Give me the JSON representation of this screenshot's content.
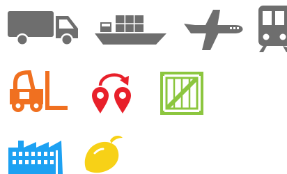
{
  "colors": {
    "gray": "#6e6e6e",
    "orange": "#f07020",
    "red": "#e8202a",
    "green": "#8cc63f",
    "blue": "#1da1f2",
    "yellow": "#f7d117",
    "white": "#ffffff"
  },
  "icons": [
    {
      "name": "truck-icon"
    },
    {
      "name": "cargo-ship-icon"
    },
    {
      "name": "airplane-icon"
    },
    {
      "name": "train-icon"
    },
    {
      "name": "forklift-icon"
    },
    {
      "name": "route-pins-icon"
    },
    {
      "name": "wooden-crate-icon"
    },
    {
      "name": "factory-icon"
    },
    {
      "name": "lemon-icon"
    }
  ]
}
